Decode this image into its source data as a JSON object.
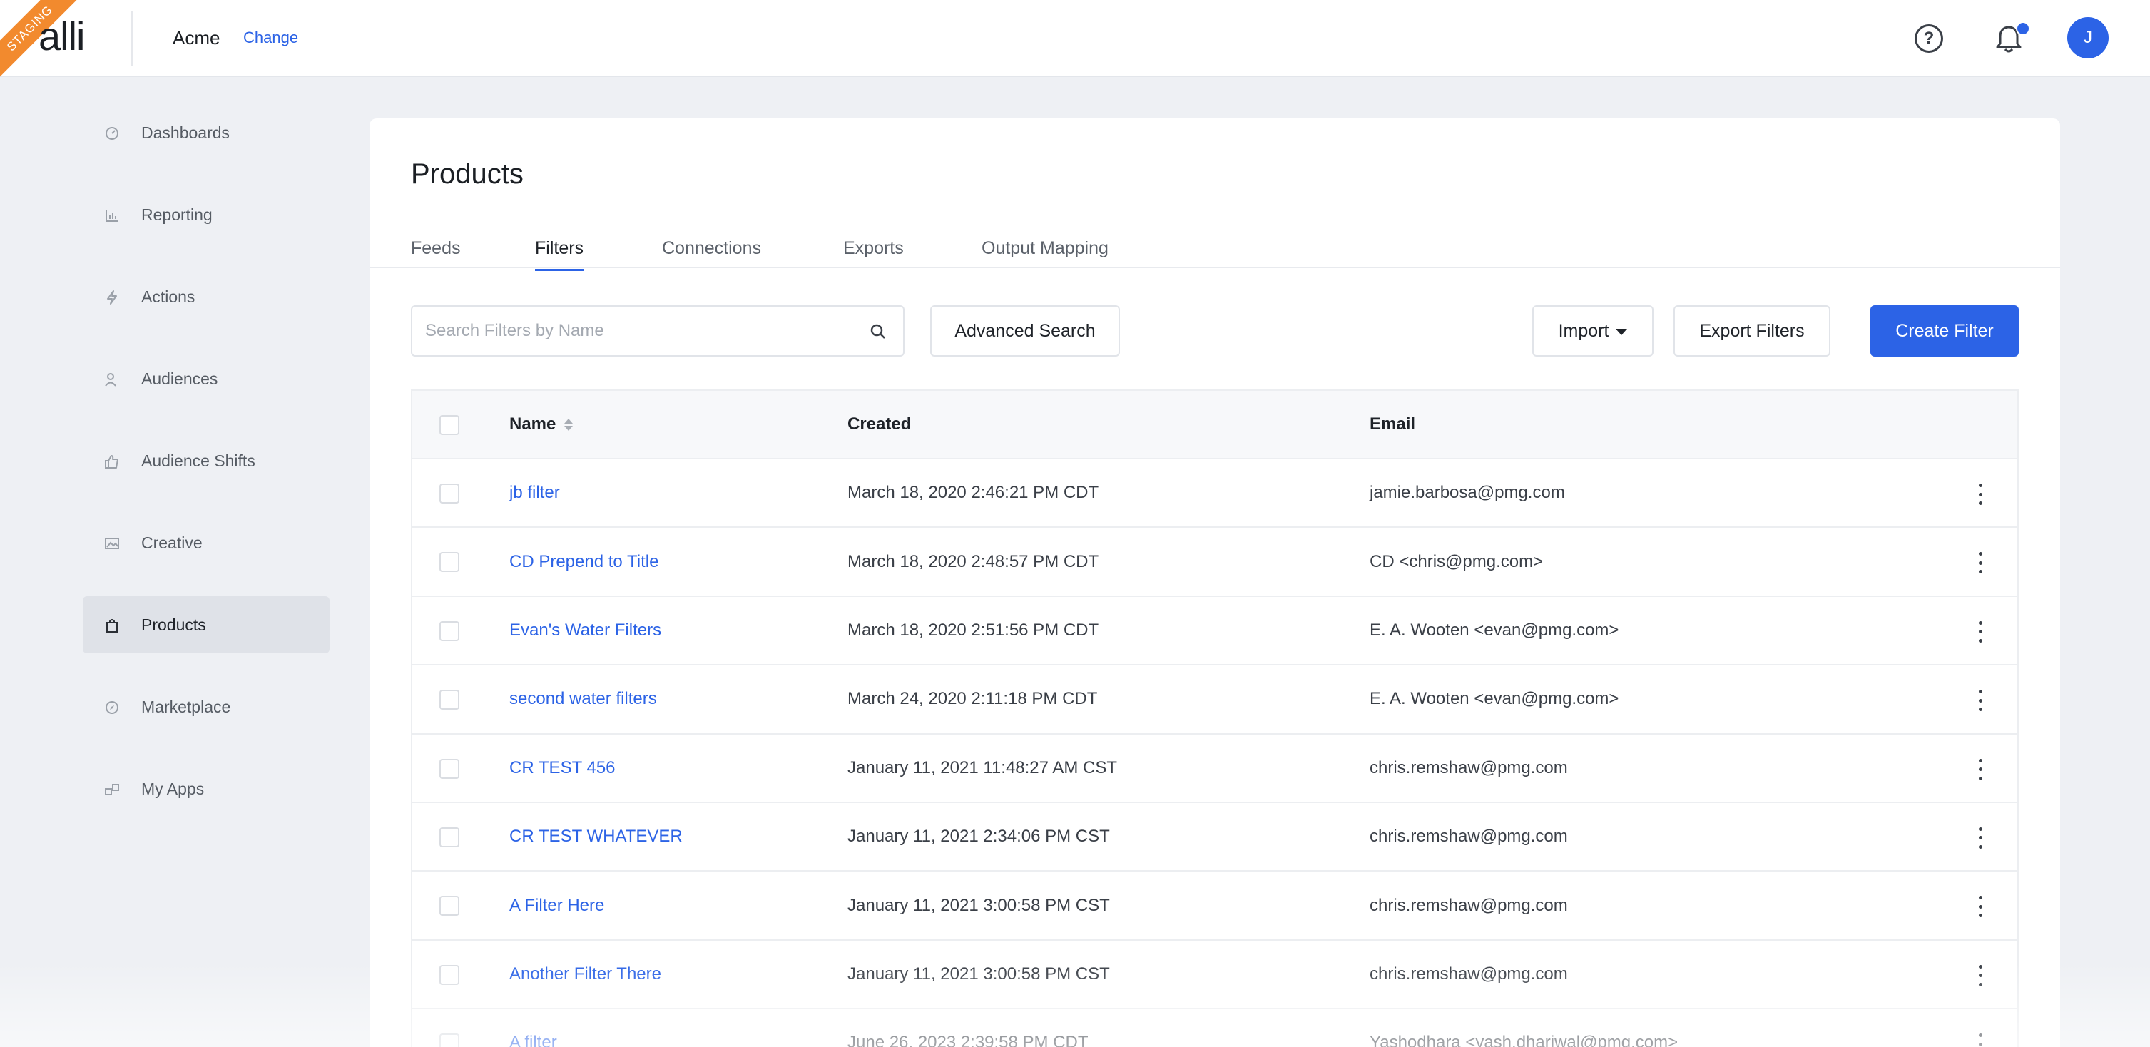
{
  "header": {
    "env_badge": "STAGING",
    "logo": "alli",
    "org_name": "Acme",
    "org_change": "Change",
    "help_icon": "help-circle-icon",
    "notifications_icon": "bell-icon",
    "avatar_initial": "J",
    "accent_color": "#2c63e6"
  },
  "sidebar": {
    "items": [
      {
        "label": "Dashboards",
        "icon": "dashboard-icon"
      },
      {
        "label": "Reporting",
        "icon": "chart-icon"
      },
      {
        "label": "Actions",
        "icon": "lightning-icon"
      },
      {
        "label": "Audiences",
        "icon": "people-icon"
      },
      {
        "label": "Audience Shifts",
        "icon": "thumbs-up-icon"
      },
      {
        "label": "Creative",
        "icon": "image-icon"
      },
      {
        "label": "Products",
        "icon": "bag-icon",
        "active": true
      },
      {
        "label": "Marketplace",
        "icon": "compass-icon"
      },
      {
        "label": "My Apps",
        "icon": "apps-icon"
      }
    ]
  },
  "main": {
    "title": "Products",
    "tabs": [
      {
        "label": "Feeds"
      },
      {
        "label": "Filters",
        "active": true
      },
      {
        "label": "Connections"
      },
      {
        "label": "Exports"
      },
      {
        "label": "Output Mapping"
      }
    ],
    "search": {
      "placeholder": "Search Filters by Name",
      "value": ""
    },
    "buttons": {
      "advanced_search": "Advanced Search",
      "import": "Import",
      "export_filters": "Export Filters",
      "create_filter": "Create Filter"
    },
    "table": {
      "columns": [
        "Name",
        "Created",
        "Email"
      ],
      "rows": [
        {
          "name": "jb filter",
          "created": "March 18, 2020 2:46:21 PM CDT",
          "email": "jamie.barbosa@pmg.com"
        },
        {
          "name": "CD Prepend to Title",
          "created": "March 18, 2020 2:48:57 PM CDT",
          "email": "CD <chris@pmg.com>"
        },
        {
          "name": "Evan's Water Filters",
          "created": "March 18, 2020 2:51:56 PM CDT",
          "email": "E. A. Wooten <evan@pmg.com>"
        },
        {
          "name": "second water filters",
          "created": "March 24, 2020 2:11:18 PM CDT",
          "email": "E. A. Wooten <evan@pmg.com>"
        },
        {
          "name": "CR TEST 456",
          "created": "January 11, 2021 11:48:27 AM CST",
          "email": "chris.remshaw@pmg.com"
        },
        {
          "name": "CR TEST WHATEVER",
          "created": "January 11, 2021 2:34:06 PM CST",
          "email": "chris.remshaw@pmg.com"
        },
        {
          "name": "A Filter Here",
          "created": "January 11, 2021 3:00:58 PM CST",
          "email": "chris.remshaw@pmg.com"
        },
        {
          "name": "Another Filter There",
          "created": "January 11, 2021 3:00:58 PM CST",
          "email": "chris.remshaw@pmg.com"
        },
        {
          "name": "A filter",
          "created": "June 26, 2023 2:39:58 PM CDT",
          "email": "Yashodhara <yash.dhariwal@pmg.com>"
        }
      ]
    }
  }
}
